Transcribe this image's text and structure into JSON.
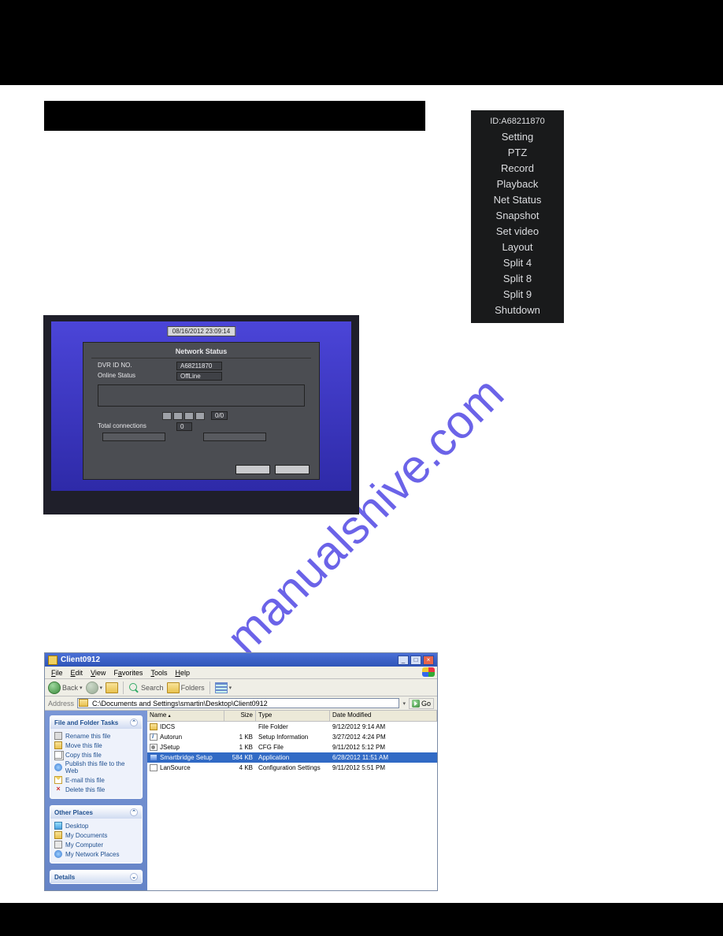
{
  "watermark": "manualshive.com",
  "context_menu": {
    "id_line": "ID:A68211870",
    "items": [
      "Setting",
      "PTZ",
      "Record",
      "Playback",
      "Net Status",
      "Snapshot",
      "Set video",
      "Layout",
      "Split 4",
      "Split 8",
      "Split 9",
      "Shutdown"
    ]
  },
  "network_status": {
    "timestamp": "08/16/2012 23:09:14",
    "title": "Network Status",
    "rows": {
      "dvr_id_label": "DVR ID NO.",
      "dvr_id_value": "A68211870",
      "online_label": "Online Status",
      "online_value": "OffLine",
      "page_text": "0/0",
      "total_label": "Total connections",
      "total_value": "0"
    }
  },
  "explorer": {
    "title": "Client0912",
    "menubar": [
      "File",
      "Edit",
      "View",
      "Favorites",
      "Tools",
      "Help"
    ],
    "toolbar": {
      "back": "Back",
      "search": "Search",
      "folders": "Folders"
    },
    "address_label": "Address",
    "address_value": "C:\\Documents and Settings\\smartin\\Desktop\\Client0912",
    "go": "Go",
    "side": {
      "panel1": {
        "title": "File and Folder Tasks",
        "items": [
          "Rename this file",
          "Move this file",
          "Copy this file",
          "Publish this file to the Web",
          "E-mail this file",
          "Delete this file"
        ]
      },
      "panel2": {
        "title": "Other Places",
        "items": [
          "Desktop",
          "My Documents",
          "My Computer",
          "My Network Places"
        ]
      },
      "panel3": {
        "title": "Details"
      }
    },
    "headers": {
      "name": "Name",
      "size": "Size",
      "type": "Type",
      "date": "Date Modified"
    },
    "files": [
      {
        "icon": "folder",
        "name": "IDCS",
        "size": "",
        "type": "File Folder",
        "date": "9/12/2012 9:14 AM"
      },
      {
        "icon": "inf",
        "name": "Autorun",
        "size": "1 KB",
        "type": "Setup Information",
        "date": "3/27/2012 4:24 PM"
      },
      {
        "icon": "cfg",
        "name": "JSetup",
        "size": "1 KB",
        "type": "CFG File",
        "date": "9/11/2012 5:12 PM"
      },
      {
        "icon": "app",
        "name": "Smartbridge Setup",
        "size": "584 KB",
        "type": "Application",
        "date": "6/28/2012 11:51 AM"
      },
      {
        "icon": "cfg2",
        "name": "LanSource",
        "size": "4 KB",
        "type": "Configuration Settings",
        "date": "9/11/2012 5:51 PM"
      }
    ],
    "selected_index": 3
  }
}
